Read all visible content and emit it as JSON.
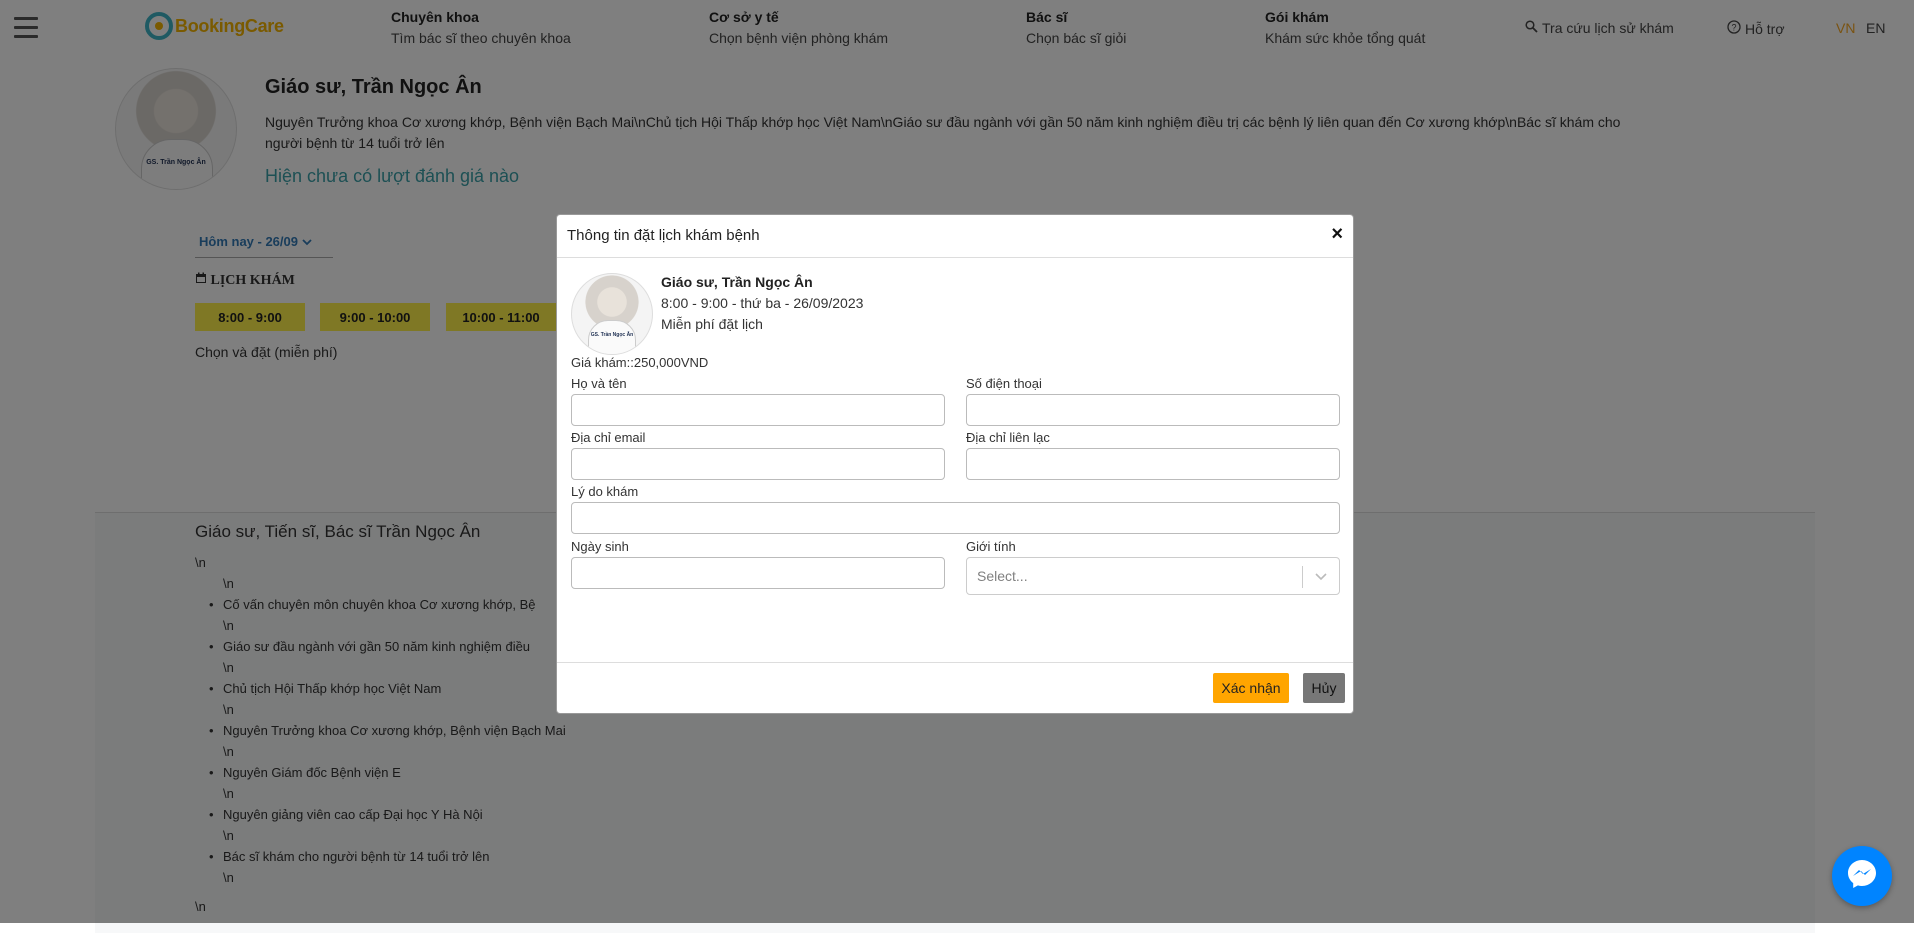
{
  "header": {
    "logo_text": "BookingCare",
    "nav": [
      {
        "title": "Chuyên khoa",
        "sub": "Tìm bác sĩ theo chuyên khoa"
      },
      {
        "title": "Cơ sở y tế",
        "sub": "Chọn bệnh viện phòng khám"
      },
      {
        "title": "Bác sĩ",
        "sub": "Chọn bác sĩ giỏi"
      },
      {
        "title": "Gói khám",
        "sub": "Khám sức khỏe tổng quát"
      }
    ],
    "history_link": "Tra cứu lịch sử khám",
    "support_link": "Hỗ trợ",
    "lang_vn": "VN",
    "lang_en": "EN",
    "colors": {
      "logo": "#f5b400",
      "lang_active": "#f5a623"
    }
  },
  "doctor": {
    "name": "Giáo sư, Trần Ngọc Ân",
    "description": "Nguyên Trưởng khoa Cơ xương khớp, Bệnh viện Bạch Mai\\nChủ tịch Hội Thấp khớp học Việt Nam\\nGiáo sư đầu ngành với gần 50 năm kinh nghiệm điều trị các bệnh lý liên quan đến Cơ xương khớp\\nBác sĩ khám cho người bệnh từ 14 tuổi trở lên",
    "rating_text": "Hiện chưa có lượt đánh giá nào",
    "avatar_caption": "GS. Trần Ngọc Ân"
  },
  "schedule": {
    "day_label": "Hôm nay - 26/09",
    "title": "LỊCH KHÁM",
    "slots": [
      "8:00 - 9:00",
      "9:00 - 10:00",
      "10:00 - 11:00"
    ],
    "note": "Chọn và đặt (miễn phí)"
  },
  "detail": {
    "title": "Giáo sư, Tiến sĩ, Bác sĩ Trần Ngọc Ân",
    "newline": "\\n",
    "items": [
      "Cố vấn chuyên môn chuyên khoa Cơ xương khớp, Bệ",
      "Giáo sư đầu ngành với gần 50 năm kinh nghiệm điều",
      "Chủ tịch Hội Thấp khớp học Việt Nam",
      "Nguyên Trưởng khoa Cơ xương khớp, Bệnh viện Bạch Mai",
      "Nguyên Giám đốc Bệnh viện E",
      "Nguyên giảng viên cao cấp Đại học Y Hà Nội",
      "Bác sĩ khám cho người bệnh từ 14 tuổi trở lên"
    ]
  },
  "modal": {
    "title": "Thông tin đặt lịch khám bệnh",
    "close": "×",
    "doctor_name": "Giáo sư, Trần Ngọc Ân",
    "time": "8:00 - 9:00 - thứ ba - 26/09/2023",
    "free_booking": "Miễn phí đặt lịch",
    "price": "Giá khám::250,000VND",
    "fields": {
      "full_name": {
        "label": "Họ và tên",
        "value": ""
      },
      "phone": {
        "label": "Số điện thoại",
        "value": ""
      },
      "email": {
        "label": "Địa chỉ email",
        "value": ""
      },
      "address": {
        "label": "Địa chỉ liên lạc",
        "value": ""
      },
      "reason": {
        "label": "Lý do khám",
        "value": ""
      },
      "birthday": {
        "label": "Ngày sinh",
        "value": ""
      },
      "gender": {
        "label": "Giới tính",
        "placeholder": "Select..."
      }
    },
    "confirm_label": "Xác nhận",
    "cancel_label": "Hủy",
    "colors": {
      "confirm": "#ffa500",
      "cancel": "#777777"
    }
  },
  "messenger": {
    "icon": "messenger-icon",
    "color": "#0084ff"
  }
}
